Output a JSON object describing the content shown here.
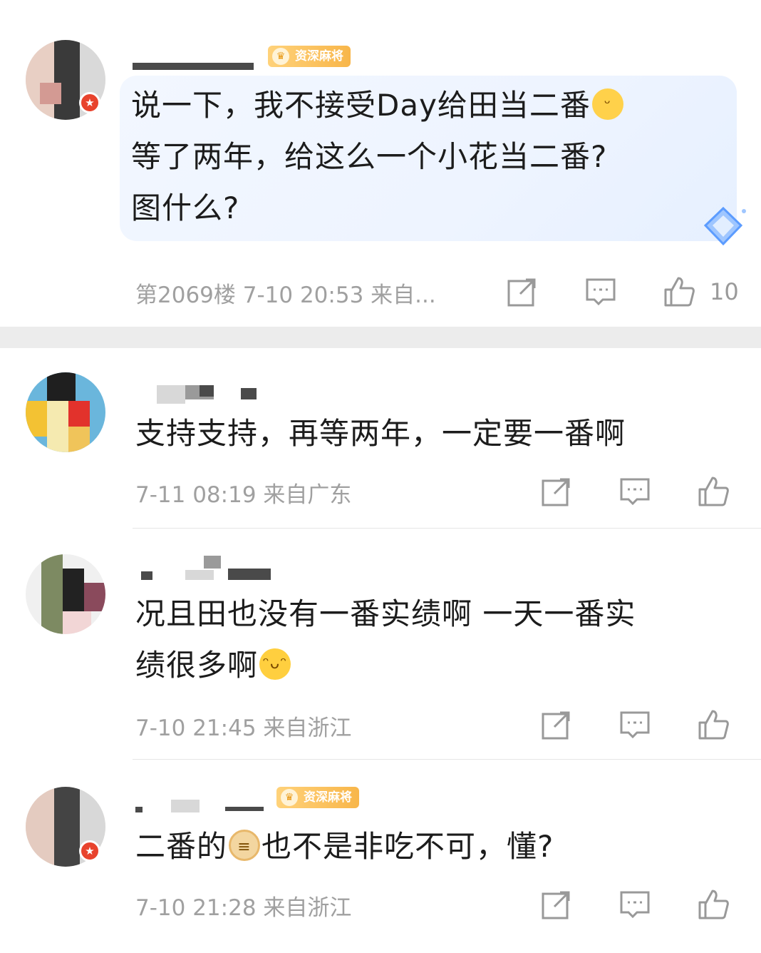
{
  "comments": [
    {
      "username": "...",
      "badge": "资深麻将",
      "text_line1": "说一下，我不接受Day给田当二番",
      "text_line2": "等了两年，给这么一个小花当二番?",
      "text_line3": "图什么?",
      "meta": "第2069楼 7-10 20:53 来自...",
      "likes": "10",
      "emoji_icon": "smirk-emoji"
    },
    {
      "username": "",
      "text": "支持支持，再等两年，一定要一番啊",
      "meta": "7-11 08:19 来自广东",
      "likes": ""
    },
    {
      "username": "",
      "text_line1": "况且田也没有一番实绩啊 一天一番实",
      "text_line2": "绩很多啊",
      "meta": "7-10 21:45 来自浙江",
      "likes": "",
      "emoji_icon": "laughing-tears-emoji"
    },
    {
      "username": "",
      "badge": "资深麻将",
      "text_before": "二番的",
      "text_after": "也不是非吃不可，懂?",
      "meta": "7-10 21:28 来自浙江",
      "likes": "",
      "emoji_icon": "cake-emoji"
    }
  ],
  "colors": {
    "meta_gray": "#a0a0a0",
    "badge_gold": "#f8b64a",
    "vip_red": "#e8432d",
    "bubble_blue": "#eef4ff",
    "separator": "#ececec"
  },
  "icons": [
    "share-icon",
    "reply-icon",
    "like-icon"
  ]
}
